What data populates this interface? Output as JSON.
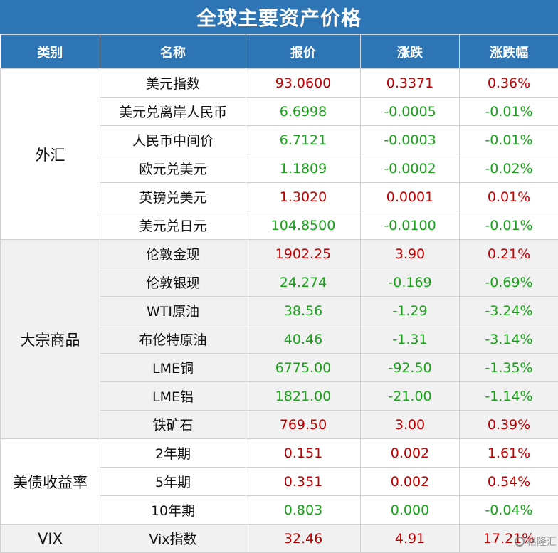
{
  "title": "全球主要资产价格",
  "headers": [
    "类别",
    "名称",
    "报价",
    "涨跌",
    "涨跌幅"
  ],
  "groups": [
    {
      "category": "外汇",
      "rows": [
        {
          "name": "美元指数",
          "price": "93.0600",
          "change": "0.3371",
          "pct": "0.36%",
          "direction": "up"
        },
        {
          "name": "美元兑离岸人民币",
          "price": "6.6998",
          "change": "-0.0005",
          "pct": "-0.01%",
          "direction": "down"
        },
        {
          "name": "人民币中间价",
          "price": "6.7121",
          "change": "-0.0003",
          "pct": "-0.01%",
          "direction": "down"
        },
        {
          "name": "欧元兑美元",
          "price": "1.1809",
          "change": "-0.0002",
          "pct": "-0.02%",
          "direction": "down"
        },
        {
          "name": "英镑兑美元",
          "price": "1.3020",
          "change": "0.0001",
          "pct": "0.01%",
          "direction": "up"
        },
        {
          "name": "美元兑日元",
          "price": "104.8500",
          "change": "-0.0100",
          "pct": "-0.01%",
          "direction": "down"
        }
      ]
    },
    {
      "category": "大宗商品",
      "rows": [
        {
          "name": "伦敦金现",
          "price": "1902.25",
          "change": "3.90",
          "pct": "0.21%",
          "direction": "up"
        },
        {
          "name": "伦敦银现",
          "price": "24.274",
          "change": "-0.169",
          "pct": "-0.69%",
          "direction": "down"
        },
        {
          "name": "WTI原油",
          "price": "38.56",
          "change": "-1.29",
          "pct": "-3.24%",
          "direction": "down"
        },
        {
          "name": "布伦特原油",
          "price": "40.46",
          "change": "-1.31",
          "pct": "-3.14%",
          "direction": "down"
        },
        {
          "name": "LME铜",
          "price": "6775.00",
          "change": "-92.50",
          "pct": "-1.35%",
          "direction": "down"
        },
        {
          "name": "LME铝",
          "price": "1821.00",
          "change": "-21.00",
          "pct": "-1.14%",
          "direction": "down"
        },
        {
          "name": "铁矿石",
          "price": "769.50",
          "change": "3.00",
          "pct": "0.39%",
          "direction": "up"
        }
      ]
    },
    {
      "category": "美债收益率",
      "rows": [
        {
          "name": "2年期",
          "price": "0.151",
          "change": "0.002",
          "pct": "1.61%",
          "direction": "up"
        },
        {
          "name": "5年期",
          "price": "0.351",
          "change": "0.002",
          "pct": "0.54%",
          "direction": "up"
        },
        {
          "name": "10年期",
          "price": "0.803",
          "change": "0.000",
          "pct": "-0.04%",
          "direction": "down"
        }
      ]
    },
    {
      "category": "VIX",
      "rows": [
        {
          "name": "Vix指数",
          "price": "32.46",
          "change": "4.91",
          "pct": "17.21%",
          "direction": "up"
        }
      ]
    }
  ],
  "watermark": "格隆汇",
  "colors": {
    "header_bg": "#2e75b6",
    "up": "#c00000",
    "down": "#1aa11a"
  }
}
